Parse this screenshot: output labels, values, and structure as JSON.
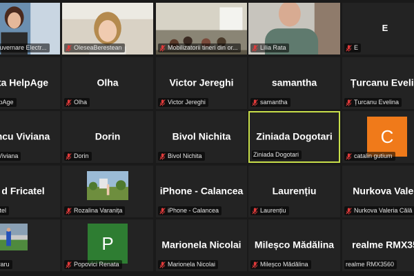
{
  "colors": {
    "background": "#1a1a1a",
    "tile": "#232323",
    "active_border": "#c9e04a",
    "mic_muted": "#e03a3a"
  },
  "tiles": [
    {
      "label": "e Guvernare Electr...",
      "muted": false,
      "video": "video-1"
    },
    {
      "label": "OleseaBerestean",
      "muted": true,
      "video": "video-2"
    },
    {
      "label": "Mobilizatorii tineri din or...",
      "muted": true,
      "video": "video-3"
    },
    {
      "label": "Lilia Rata",
      "muted": true,
      "video": "video-4"
    },
    {
      "name": "E",
      "label": "E",
      "muted": true
    },
    {
      "name": "ta HelpAge",
      "label": "HelpAge",
      "muted": false
    },
    {
      "name": "Olha",
      "label": "Olha",
      "muted": true
    },
    {
      "name": "Victor Jereghi",
      "label": "Victor Jereghi",
      "muted": true
    },
    {
      "name": "samantha",
      "label": "samantha",
      "muted": true
    },
    {
      "name": "Țurcanu Evelin",
      "label": "Țurcanu Evelina",
      "muted": true
    },
    {
      "name": "ncu Viviana",
      "label": "cu Viviana",
      "muted": false
    },
    {
      "name": "Dorin",
      "label": "Dorin",
      "muted": true
    },
    {
      "name": "Bivol Nichita",
      "label": "Bivol Nichita",
      "muted": true
    },
    {
      "name": "Ziniada Dogotari",
      "label": "Ziniada Dogotari",
      "muted": false,
      "active": true
    },
    {
      "avatar": "C",
      "avatar_color": "#f07a1a",
      "label": "catalin gutium",
      "muted": true
    },
    {
      "name": "d Fricatel",
      "label": "ricatel",
      "muted": false
    },
    {
      "label": "Rozalina Varanița",
      "muted": true,
      "video": "photo-1"
    },
    {
      "name": "iPhone - Calancea",
      "label": "iPhone - Calancea",
      "muted": true
    },
    {
      "name": "Laurențiu",
      "label": "Laurențiu",
      "muted": true
    },
    {
      "name": "Nurkova  Valer",
      "label": "Nurkova Valeria Călă",
      "muted": true
    },
    {
      "label": "Moraru",
      "muted": false,
      "video": "photo-2"
    },
    {
      "avatar": "P",
      "avatar_color": "#2e7d32",
      "label": "Popovici Renata",
      "muted": true
    },
    {
      "name": "Marionela Nicolai",
      "label": "Marionela Nicolai",
      "muted": true
    },
    {
      "name": "Mileșco Mădălina",
      "label": "Mileșco Mădălina",
      "muted": true
    },
    {
      "name": "realme RMX35",
      "label": "realme RMX3560",
      "muted": false
    }
  ]
}
